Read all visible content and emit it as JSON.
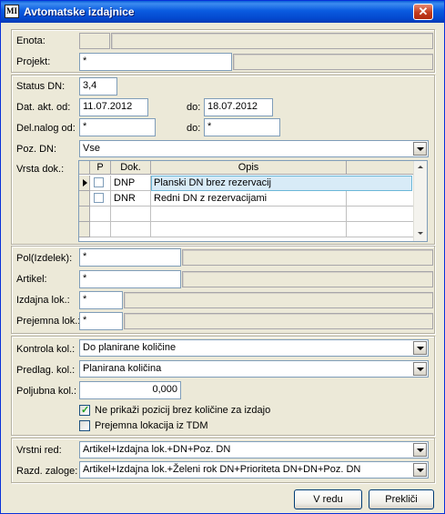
{
  "window": {
    "title": "Avtomatske izdajnice",
    "icon_text": "MI",
    "close_glyph": "✕"
  },
  "header": {
    "enota": {
      "label": "Enota:",
      "value": ""
    },
    "projekt": {
      "label": "Projekt:",
      "value": "*"
    }
  },
  "filters": {
    "status_dn": {
      "label": "Status DN:",
      "value": "3,4"
    },
    "dat_akt": {
      "label": "Dat. akt. od:",
      "from": "11.07.2012",
      "to_label": "do:",
      "to": "18.07.2012"
    },
    "del_nalog": {
      "label": "Del.nalog od:",
      "from": "*",
      "to_label": "do:",
      "to": "*"
    },
    "poz_dn": {
      "label": "Poz. DN:",
      "value": "Vse"
    },
    "vrsta_dok": {
      "label": "Vrsta dok.:",
      "columns": [
        "P",
        "Dok.",
        "Opis"
      ],
      "rows": [
        {
          "dok": "DNP",
          "opis": "Planski DN brez rezervacij",
          "checked": false,
          "current": true
        },
        {
          "dok": "DNR",
          "opis": "Redni DN z rezervacijami",
          "checked": false,
          "current": false
        }
      ]
    }
  },
  "items": {
    "pol": {
      "label": "Pol(Izdelek):",
      "value": "*"
    },
    "artikel": {
      "label": "Artikel:",
      "value": "*"
    },
    "izdajna": {
      "label": "Izdajna lok.:",
      "value": "*"
    },
    "prejemna": {
      "label": "Prejemna lok.:",
      "value": "*"
    }
  },
  "quantities": {
    "kontrola": {
      "label": "Kontrola kol.:",
      "value": "Do planirane količine"
    },
    "predlag": {
      "label": "Predlag. kol.:",
      "value": "Planirana količina"
    },
    "poljubna": {
      "label": "Poljubna kol.:",
      "value": "0,000"
    },
    "check1": {
      "label": "Ne prikaži pozicij brez količine za izdajo",
      "checked": true,
      "mark": "✓"
    },
    "check2": {
      "label": "Prejemna lokacija iz TDM",
      "checked": false
    }
  },
  "order": {
    "vrstni_red": {
      "label": "Vrstni red:",
      "value": "Artikel+Izdajna lok.+DN+Poz. DN"
    },
    "razd_zaloge": {
      "label": "Razd. zaloge:",
      "value": "Artikel+Izdajna lok.+Želeni rok DN+Prioriteta DN+DN+Poz. DN"
    }
  },
  "buttons": {
    "ok": "V redu",
    "cancel": "Prekliči"
  }
}
